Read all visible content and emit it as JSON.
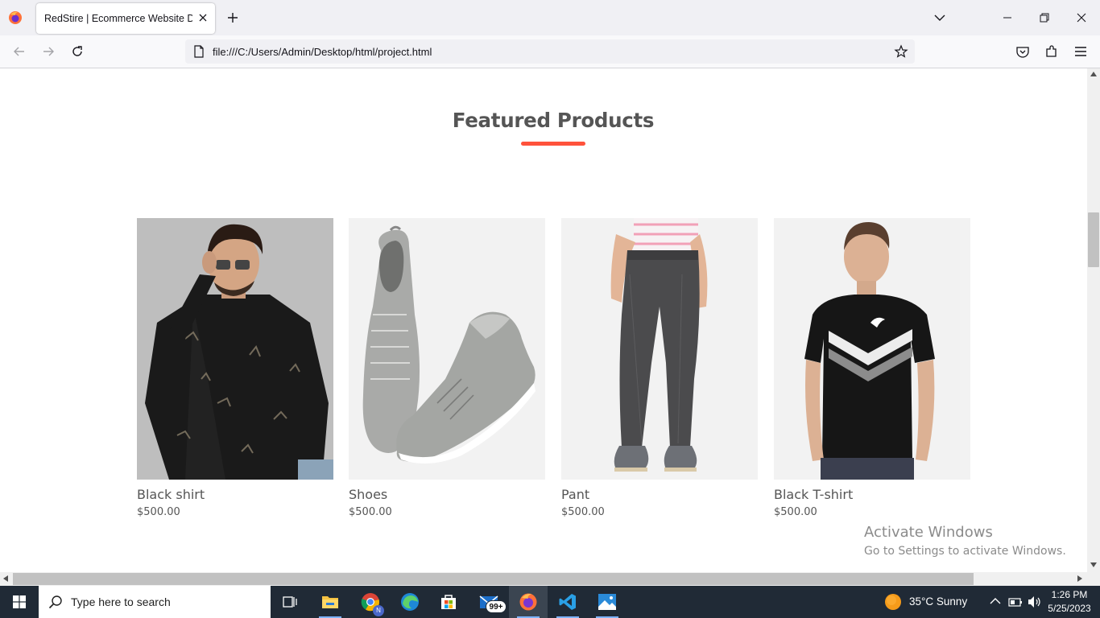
{
  "browser": {
    "tab_title": "RedStire | Ecommerce Website Design",
    "url": "file:///C:/Users/Admin/Desktop/html/project.html"
  },
  "page": {
    "heading": "Featured Products",
    "accent_color": "#ff523b",
    "products": [
      {
        "name": "Black shirt",
        "price": "$500.00"
      },
      {
        "name": "Shoes",
        "price": "$500.00"
      },
      {
        "name": "Pant",
        "price": "$500.00"
      },
      {
        "name": "Black T-shirt",
        "price": "$500.00"
      }
    ]
  },
  "watermark": {
    "title": "Activate Windows",
    "subtitle": "Go to Settings to activate Windows."
  },
  "taskbar": {
    "search_placeholder": "Type here to search",
    "mail_badge": "99+",
    "chrome_badge": "N",
    "weather": "35°C  Sunny",
    "time": "1:26 PM",
    "date": "5/25/2023"
  }
}
